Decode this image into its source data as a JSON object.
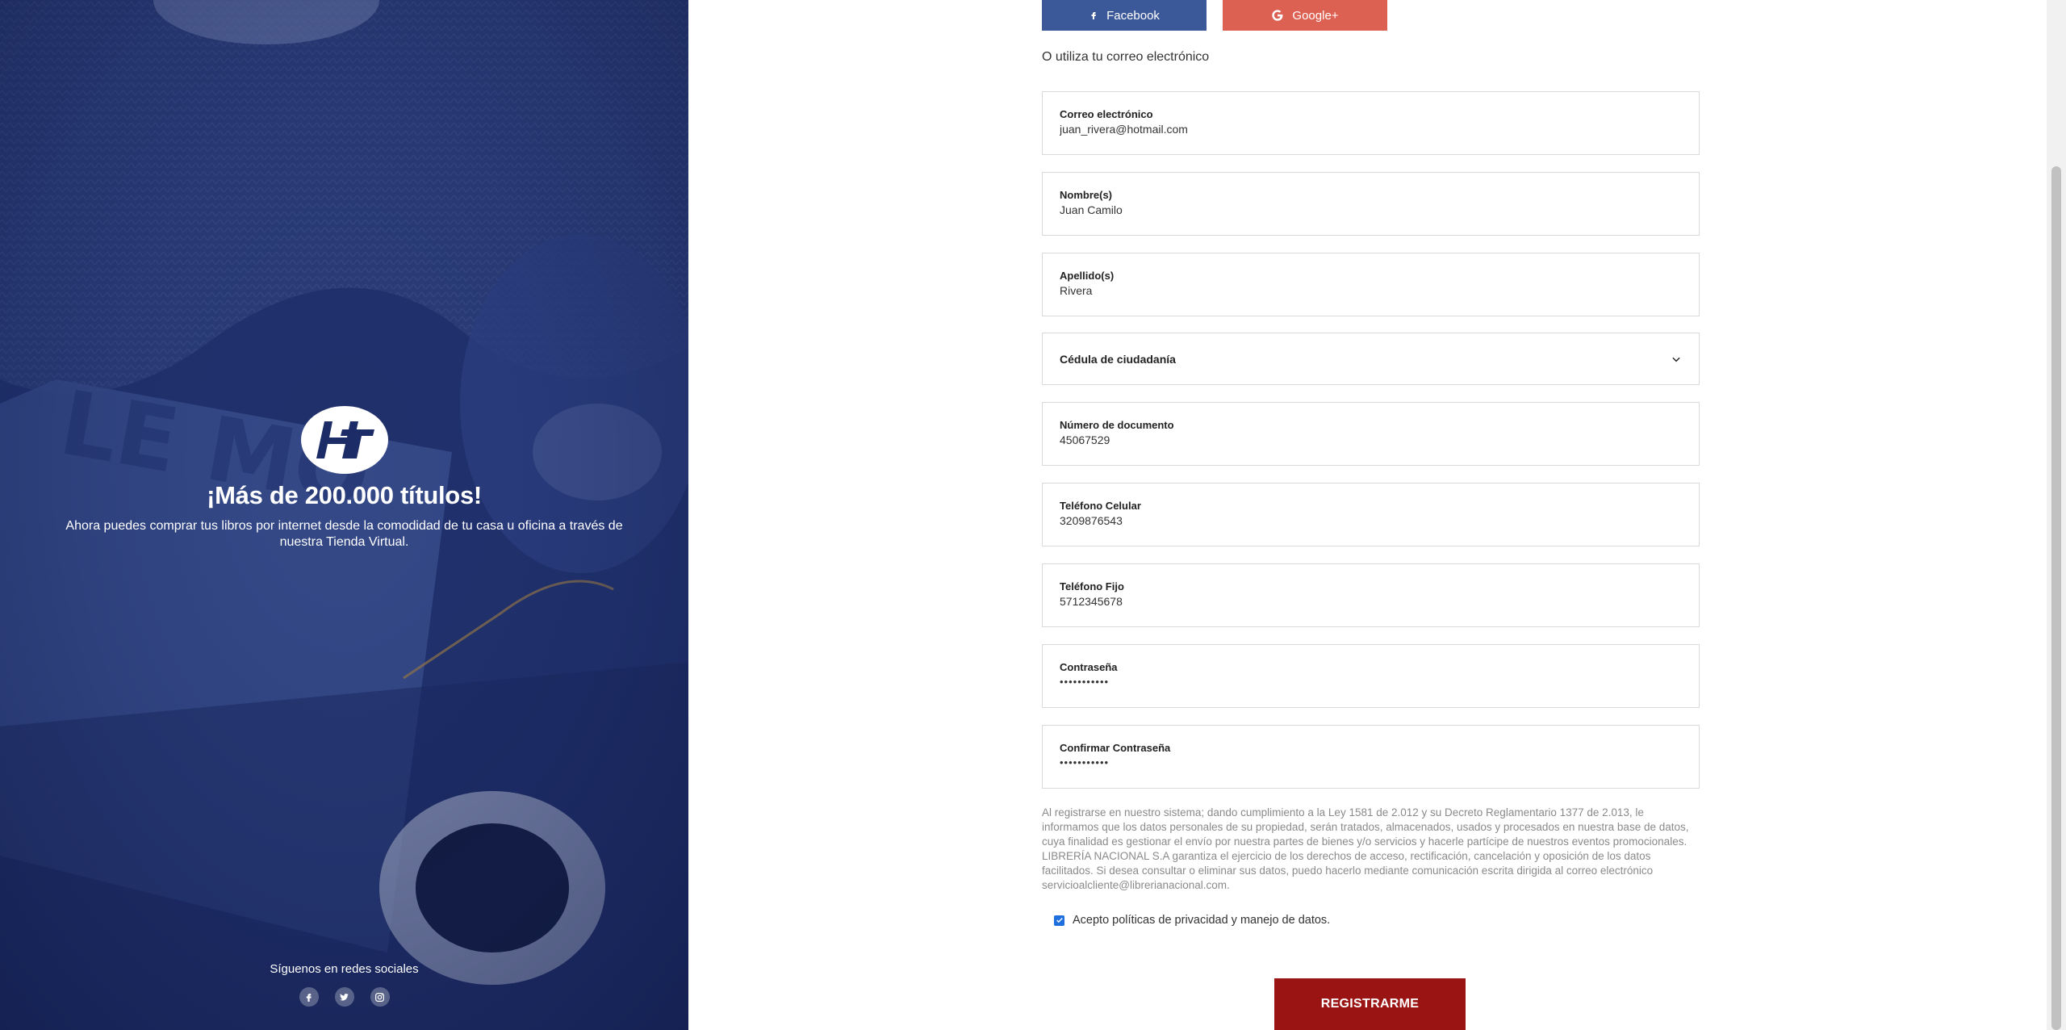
{
  "left_panel": {
    "headline": "¡Más de 200.000 títulos!",
    "description": "Ahora puedes comprar tus libros por internet desde la comodidad de tu casa u oficina a través de nuestra Tienda Virtual.",
    "social_label": "Síguenos en redes sociales",
    "social_icons": [
      "facebook-icon",
      "twitter-icon",
      "instagram-icon"
    ],
    "bg_color": "#1c2c66"
  },
  "social_login": {
    "facebook_label": "Facebook",
    "google_label": "Google+",
    "facebook_color": "#3b5998",
    "google_color": "#dd6153"
  },
  "or_text": "O utiliza tu correo electrónico",
  "form": {
    "email": {
      "label": "Correo electrónico",
      "value": "juan_rivera@hotmail.com"
    },
    "first_name": {
      "label": "Nombre(s)",
      "value": "Juan Camilo"
    },
    "last_name": {
      "label": "Apellido(s)",
      "value": "Rivera"
    },
    "doc_type": {
      "selected": "Cédula de ciudadanía"
    },
    "doc_number": {
      "label": "Número de documento",
      "value": "45067529"
    },
    "mobile": {
      "label": "Teléfono Celular",
      "value": "3209876543"
    },
    "landline": {
      "label": "Teléfono Fijo",
      "value": "5712345678"
    },
    "password": {
      "label": "Contraseña",
      "value": "•••••••••••"
    },
    "confirm_password": {
      "label": "Confirmar Contraseña",
      "value": "•••••••••••"
    }
  },
  "legal_text": "Al registrarse en nuestro sistema; dando cumplimiento a la Ley 1581 de 2.012 y su Decreto Reglamentario 1377 de 2.013, le informamos que los datos personales de su propiedad, serán tratados, almacenados, usados y procesados en nuestra base de datos, cuya finalidad es gestionar el envío por nuestra partes de bienes y/o servicios y hacerle partícipe de nuestros eventos promocionales. LIBRERÍA NACIONAL S.A garantiza el ejercicio de los derechos de acceso, rectificación, cancelación y oposición de los datos facilitados. Si desea consultar o eliminar sus datos, puedo hacerlo mediante comunicación escrita dirigida al correo electrónico servicioalcliente@librerianacional.com.",
  "accept_label": "Acepto políticas de privacidad y manejo de datos.",
  "accept_checked": true,
  "submit_label": "REGISTRARME",
  "submit_color": "#9b1414"
}
